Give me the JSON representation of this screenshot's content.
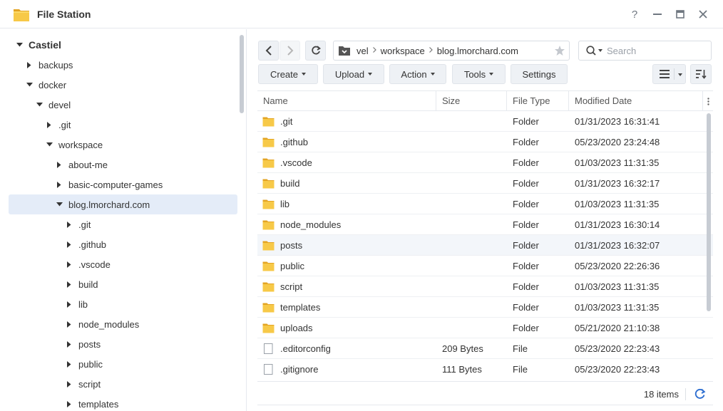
{
  "window": {
    "title": "File Station",
    "help_label": "?"
  },
  "sidebar": {
    "items": [
      {
        "label": "Castiel",
        "level": 0,
        "expanded": true,
        "root": true
      },
      {
        "label": "backups",
        "level": 1,
        "expanded": false
      },
      {
        "label": "docker",
        "level": 1,
        "expanded": true
      },
      {
        "label": "devel",
        "level": 2,
        "expanded": true
      },
      {
        "label": ".git",
        "level": 3,
        "expanded": false
      },
      {
        "label": "workspace",
        "level": 3,
        "expanded": true
      },
      {
        "label": "about-me",
        "level": 4,
        "expanded": false
      },
      {
        "label": "basic-computer-games",
        "level": 4,
        "expanded": false
      },
      {
        "label": "blog.lmorchard.com",
        "level": 4,
        "expanded": true,
        "selected": true
      },
      {
        "label": ".git",
        "level": 5,
        "expanded": false
      },
      {
        "label": ".github",
        "level": 5,
        "expanded": false
      },
      {
        "label": ".vscode",
        "level": 5,
        "expanded": false
      },
      {
        "label": "build",
        "level": 5,
        "expanded": false
      },
      {
        "label": "lib",
        "level": 5,
        "expanded": false
      },
      {
        "label": "node_modules",
        "level": 5,
        "expanded": false
      },
      {
        "label": "posts",
        "level": 5,
        "expanded": false
      },
      {
        "label": "public",
        "level": 5,
        "expanded": false
      },
      {
        "label": "script",
        "level": 5,
        "expanded": false
      },
      {
        "label": "templates",
        "level": 5,
        "expanded": false
      }
    ]
  },
  "path": {
    "crumbs": [
      "vel",
      "workspace",
      "blog.lmorchard.com"
    ]
  },
  "search": {
    "placeholder": "Search"
  },
  "toolbar": {
    "create_label": "Create",
    "upload_label": "Upload",
    "action_label": "Action",
    "tools_label": "Tools",
    "settings_label": "Settings"
  },
  "table": {
    "columns": {
      "name": "Name",
      "size": "Size",
      "type": "File Type",
      "modified": "Modified Date"
    },
    "rows": [
      {
        "name": ".git",
        "size": "",
        "type": "Folder",
        "modified": "01/31/2023 16:31:41",
        "icon": "folder-icon"
      },
      {
        "name": ".github",
        "size": "",
        "type": "Folder",
        "modified": "05/23/2020 23:24:48",
        "icon": "folder-icon"
      },
      {
        "name": ".vscode",
        "size": "",
        "type": "Folder",
        "modified": "01/03/2023 11:31:35",
        "icon": "folder-icon"
      },
      {
        "name": "build",
        "size": "",
        "type": "Folder",
        "modified": "01/31/2023 16:32:17",
        "icon": "folder-icon"
      },
      {
        "name": "lib",
        "size": "",
        "type": "Folder",
        "modified": "01/03/2023 11:31:35",
        "icon": "folder-icon"
      },
      {
        "name": "node_modules",
        "size": "",
        "type": "Folder",
        "modified": "01/31/2023 16:30:14",
        "icon": "folder-icon"
      },
      {
        "name": "posts",
        "size": "",
        "type": "Folder",
        "modified": "01/31/2023 16:32:07",
        "icon": "folder-icon",
        "hover": true
      },
      {
        "name": "public",
        "size": "",
        "type": "Folder",
        "modified": "05/23/2020 22:26:36",
        "icon": "folder-icon"
      },
      {
        "name": "script",
        "size": "",
        "type": "Folder",
        "modified": "01/03/2023 11:31:35",
        "icon": "folder-icon"
      },
      {
        "name": "templates",
        "size": "",
        "type": "Folder",
        "modified": "01/03/2023 11:31:35",
        "icon": "folder-icon"
      },
      {
        "name": "uploads",
        "size": "",
        "type": "Folder",
        "modified": "05/21/2020 21:10:38",
        "icon": "folder-icon"
      },
      {
        "name": ".editorconfig",
        "size": "209 Bytes",
        "type": "File",
        "modified": "05/23/2020 22:23:43",
        "icon": "file-icon"
      },
      {
        "name": ".gitignore",
        "size": "111 Bytes",
        "type": "File",
        "modified": "05/23/2020 22:23:43",
        "icon": "file-icon"
      }
    ]
  },
  "footer": {
    "count_label": "18 items"
  },
  "colors": {
    "accent": "#2f6fd1",
    "folder": "#f3c13a",
    "selection": "#e4ecf8"
  }
}
